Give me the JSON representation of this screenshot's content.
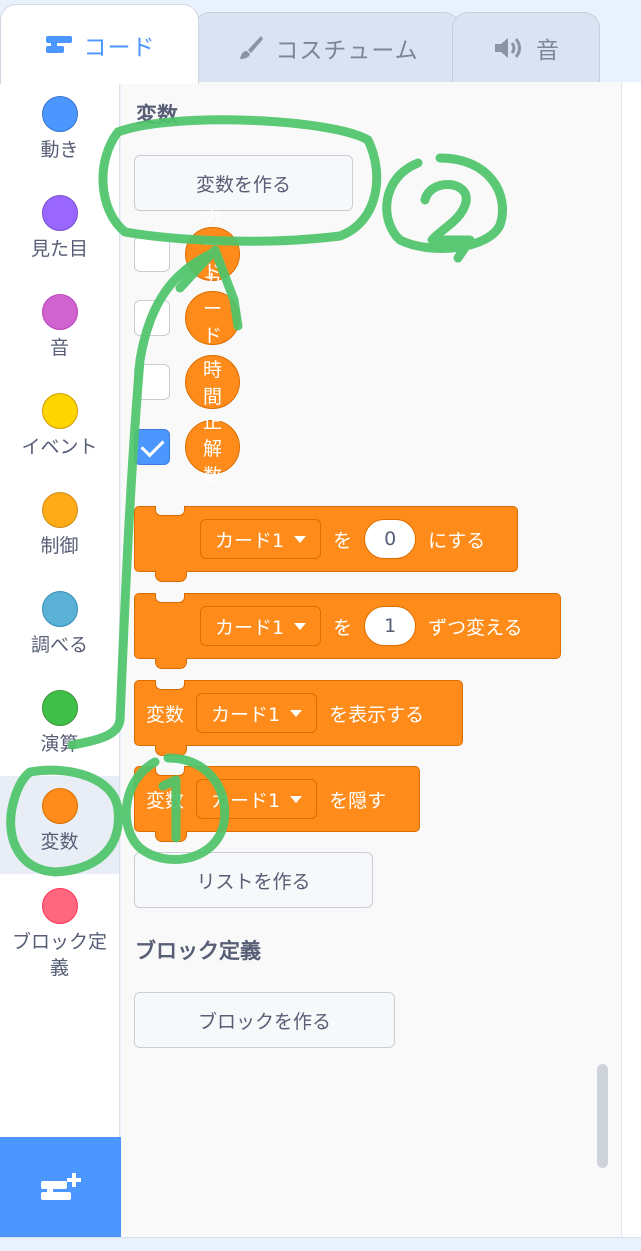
{
  "tabs": [
    {
      "label": "コード",
      "icon": "code-blocks-icon",
      "active": true
    },
    {
      "label": "コスチューム",
      "icon": "paintbrush-icon",
      "active": false
    },
    {
      "label": "音",
      "icon": "speaker-icon",
      "active": false
    }
  ],
  "categories": [
    {
      "label": "動き",
      "color": "#4c97ff"
    },
    {
      "label": "見た目",
      "color": "#9966ff"
    },
    {
      "label": "音",
      "color": "#cf63cf"
    },
    {
      "label": "イベント",
      "color": "#ffd500"
    },
    {
      "label": "制御",
      "color": "#ffab19"
    },
    {
      "label": "調べる",
      "color": "#5cb1d6"
    },
    {
      "label": "演算",
      "color": "#40bf4a"
    },
    {
      "label": "変数",
      "color": "#ff8c1a",
      "selected": true
    },
    {
      "label": "ブロック定",
      "label2": "義",
      "color": "#ff6680"
    }
  ],
  "palette": {
    "variables_title": "変数",
    "make_variable_button": "変数を作る",
    "variables": [
      {
        "name": "カード1",
        "checked": false
      },
      {
        "name": "カード2",
        "checked": false
      },
      {
        "name": "時間",
        "checked": false
      },
      {
        "name": "正解数",
        "checked": true
      }
    ],
    "blocks": {
      "set": {
        "dropdown": "カード1",
        "text_a": "を",
        "value": "0",
        "text_b": "にする"
      },
      "change": {
        "dropdown": "カード1",
        "text_a": "を",
        "value": "1",
        "text_b": "ずつ変える"
      },
      "show": {
        "prefix": "変数",
        "dropdown": "カード1",
        "text": "を表示する"
      },
      "hide": {
        "prefix": "変数",
        "dropdown": "カード1",
        "text": "を隠す"
      }
    },
    "make_list_button": "リストを作る",
    "my_blocks_title": "ブロック定義",
    "make_block_button": "ブロックを作る"
  },
  "extension_button_icon": "add-extension-icon",
  "annotations": {
    "color": "#4ec46a",
    "labels": [
      "1",
      "2"
    ]
  }
}
